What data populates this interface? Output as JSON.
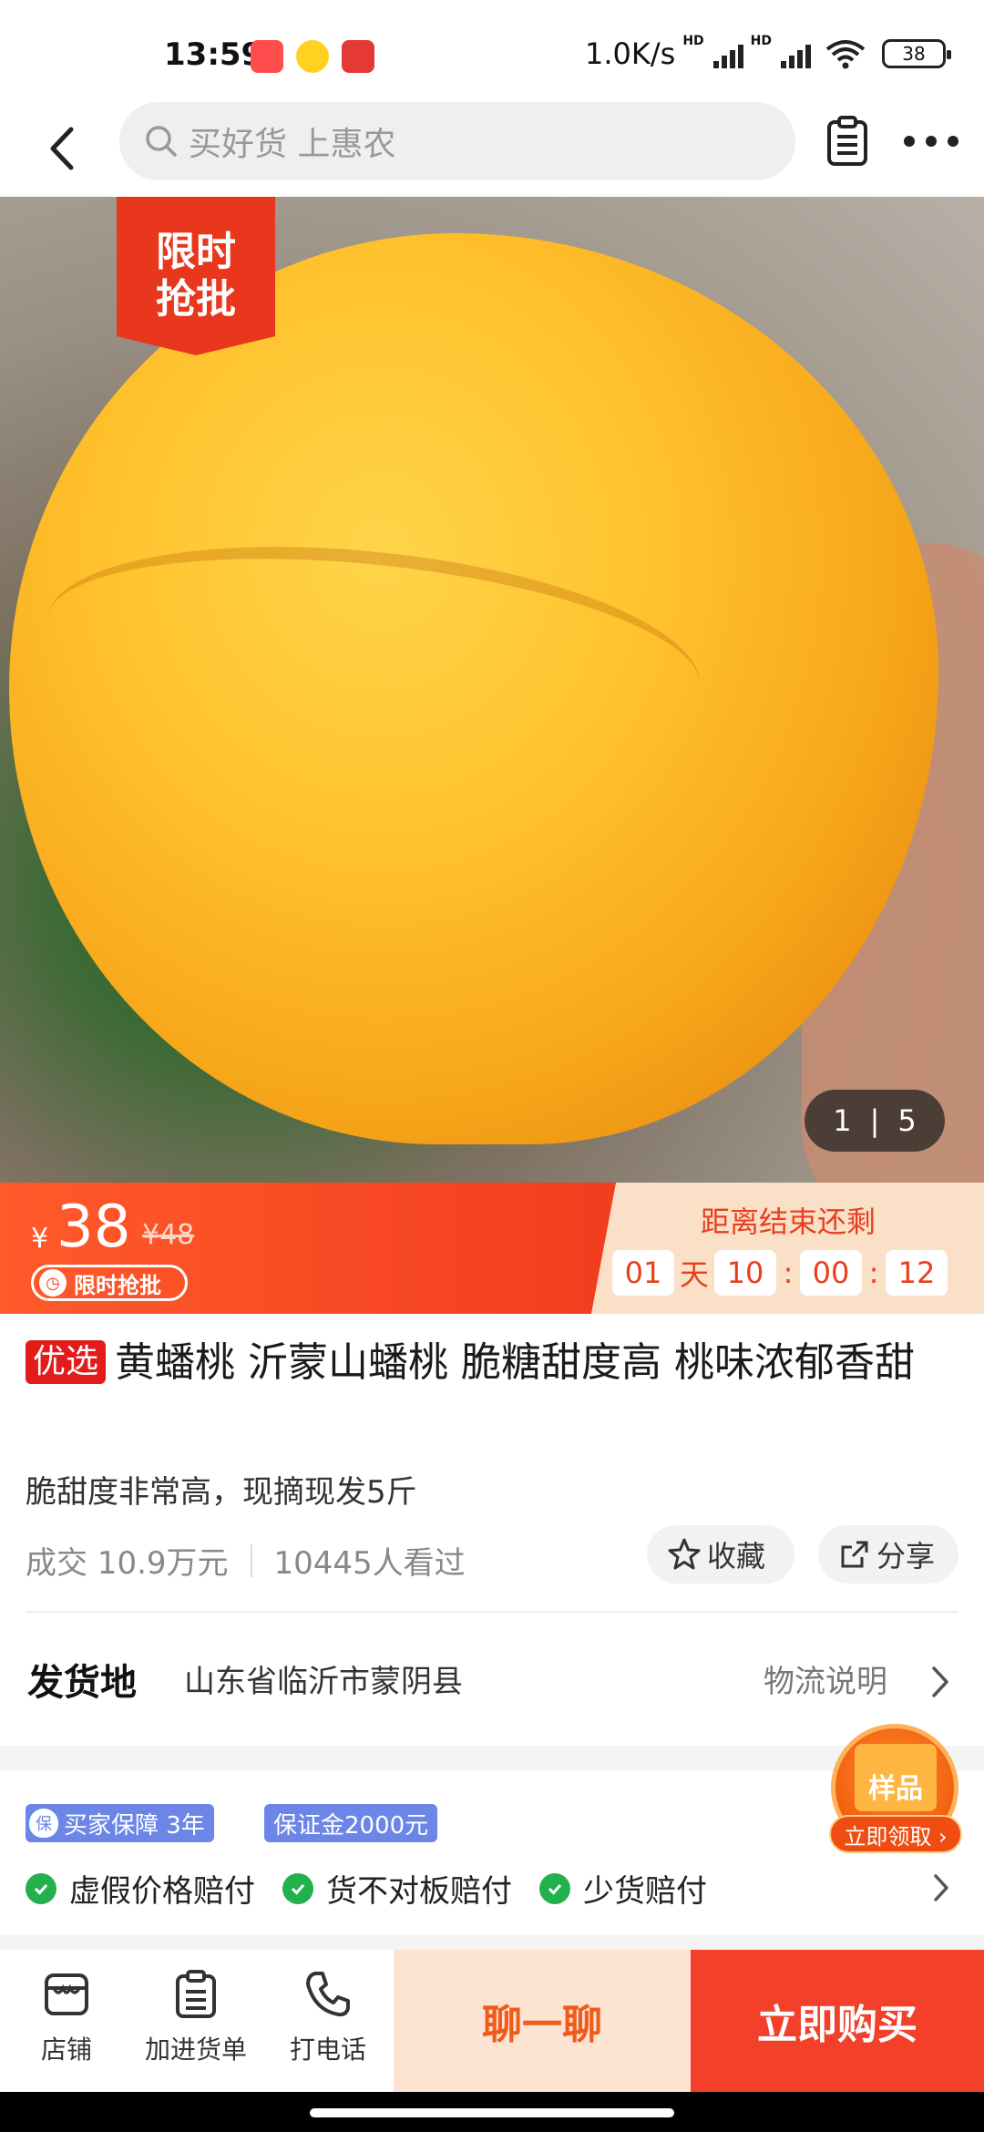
{
  "status_bar": {
    "time": "13:59",
    "network_speed": "1.0K/s",
    "hd1": "HD",
    "hd2": "HD",
    "battery": "38"
  },
  "nav": {
    "search_placeholder": "买好货 上惠农"
  },
  "gallery": {
    "badge_line1": "限时",
    "badge_line2": "抢批",
    "current": "1",
    "separator": "|",
    "total": "5"
  },
  "price": {
    "currency": "¥",
    "current": "38",
    "original": "¥48",
    "tag": "限时抢批"
  },
  "countdown": {
    "title": "距离结束还剩",
    "days": "01",
    "day_unit": "天",
    "hours": "10",
    "sep1": ":",
    "minutes": "00",
    "sep2": ":",
    "seconds": "12"
  },
  "product": {
    "tag": "优选",
    "title": "黄蟠桃 沂蒙山蟠桃 脆糖甜度高 桃味浓郁香甜",
    "subtitle": "脆甜度非常高，现摘现发5斤",
    "sold": "成交 10.9万元",
    "views": "10445人看过",
    "favorite": "收藏",
    "share": "分享"
  },
  "shipping": {
    "label": "发货地",
    "value": "山东省临沂市蒙阴县",
    "logistics": "物流说明"
  },
  "guarantee": {
    "shield": "保",
    "tag1": "买家保障 3年",
    "tag2": "保证金2000元",
    "items": [
      "虚假价格赔付",
      "货不对板赔付",
      "少货赔付"
    ]
  },
  "sample": {
    "box_label": "样品",
    "pill": "立即领取 ›"
  },
  "bottom_bar": {
    "store": "店铺",
    "add_list": "加进货单",
    "call": "打电话",
    "chat": "聊一聊",
    "buy": "立即购买"
  },
  "colors": {
    "accent_red": "#f3402a",
    "price_orange": "#ff5a2a",
    "chat_bg": "#fde3d1",
    "guarantee_blue": "#6c86e8",
    "check_green": "#22b14c"
  }
}
